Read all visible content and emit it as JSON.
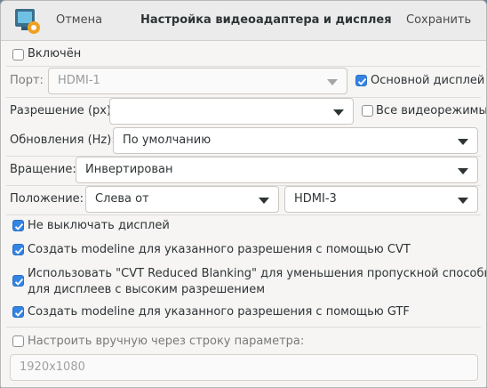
{
  "header": {
    "cancel_label": "Отмена",
    "title": "Настройка видеоадаптера и дисплея",
    "save_label": "Сохранить"
  },
  "enabled": {
    "label": "Включён",
    "checked": false
  },
  "port": {
    "label": "Порт:",
    "value": "HDMI-1",
    "disabled": true
  },
  "primary": {
    "label": "Основной дисплей",
    "checked": true
  },
  "resolution": {
    "label": "Разрешение (px):",
    "value": ""
  },
  "all_modes": {
    "label": "Все видеорежимы",
    "checked": false
  },
  "refresh": {
    "label": "Обновления (Hz):",
    "value": "По умолчанию"
  },
  "rotation": {
    "label": "Вращение:",
    "value": "Инвертирован"
  },
  "position": {
    "label": "Положение:",
    "relation": "Слева от",
    "target": "HDMI-3"
  },
  "options": [
    {
      "label": "Не выключать дисплей",
      "checked": true
    },
    {
      "label": "Создать modeline для указанного разрешения с помощью CVT",
      "checked": true
    },
    {
      "label_line1": "Использовать \"CVT Reduced Blanking\" для уменьшения пропускной способности",
      "label_line2": "для дисплеев с высоким разрешением",
      "checked": true
    },
    {
      "label": "Создать modeline для указанного разрешения с помощью GTF",
      "checked": true
    }
  ],
  "manual": {
    "label": "Настроить вручную через строку параметра:",
    "checked": false,
    "placeholder": "1920x1080"
  },
  "colors": {
    "accent": "#3584e4",
    "window_bg": "#f6f5f4",
    "header_bg": "#ebebeb"
  }
}
